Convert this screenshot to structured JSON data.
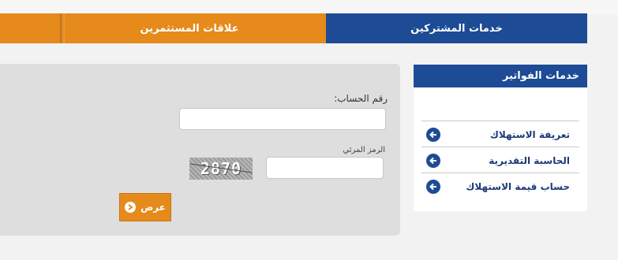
{
  "nav": {
    "tab_subscribers": "خدمات المشتركين",
    "tab_investors": "علاقات المستثمرين"
  },
  "sidebar": {
    "title": "خدمات الفواتير",
    "items": [
      {
        "label": "تعريفة الاستهلاك",
        "icon": "arrow-left-circle-icon"
      },
      {
        "label": "الحاسبة التقديرية",
        "icon": "arrow-left-circle-icon"
      },
      {
        "label": "حساب قيمة الاستهلاك",
        "icon": "arrow-left-circle-icon"
      }
    ]
  },
  "form": {
    "account_label": "رقم الحساب:",
    "account_value": "",
    "captcha_label": "الرمز المرئي",
    "captcha_value": "",
    "captcha_code": "2870",
    "submit_label": "عرض"
  },
  "colors": {
    "brand_blue": "#1d4b96",
    "brand_orange": "#e58a1b",
    "panel_gray": "#dedede"
  }
}
